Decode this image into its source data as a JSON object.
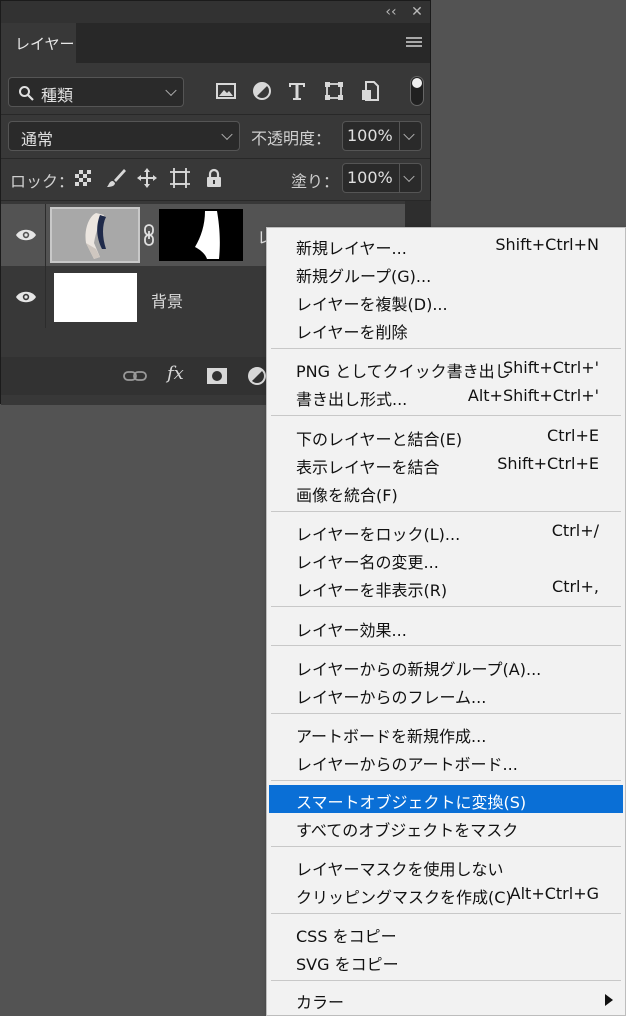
{
  "panel": {
    "tab_label": "レイヤー",
    "collapse_glyph": "‹‹",
    "close_glyph": "✕",
    "filter": {
      "kind_label": "種類"
    },
    "blend_mode": "通常",
    "opacity_label": "不透明度：",
    "opacity_value": "100%",
    "lock_label": "ロック：",
    "fill_label": "塗り：",
    "fill_value": "100%",
    "layers": [
      {
        "name": "レイ",
        "has_mask": true
      },
      {
        "name": "背景",
        "has_mask": false
      }
    ],
    "fx_label": "fx"
  },
  "menu": {
    "items": [
      {
        "label": "新規レイヤー...",
        "shortcut": "Shift+Ctrl+N"
      },
      {
        "label": "新規グループ(G)...",
        "shortcut": ""
      },
      {
        "label": "レイヤーを複製(D)...",
        "shortcut": ""
      },
      {
        "label": "レイヤーを削除",
        "shortcut": ""
      },
      {
        "label": "PNG としてクイック書き出し",
        "shortcut": "Shift+Ctrl+'"
      },
      {
        "label": "書き出し形式...",
        "shortcut": "Alt+Shift+Ctrl+'"
      },
      {
        "label": "下のレイヤーと結合(E)",
        "shortcut": "Ctrl+E"
      },
      {
        "label": "表示レイヤーを結合",
        "shortcut": "Shift+Ctrl+E"
      },
      {
        "label": "画像を統合(F)",
        "shortcut": ""
      },
      {
        "label": "レイヤーをロック(L)...",
        "shortcut": "Ctrl+/"
      },
      {
        "label": "レイヤー名の変更...",
        "shortcut": ""
      },
      {
        "label": "レイヤーを非表示(R)",
        "shortcut": "Ctrl+,"
      },
      {
        "label": "レイヤー効果...",
        "shortcut": ""
      },
      {
        "label": "レイヤーからの新規グループ(A)...",
        "shortcut": ""
      },
      {
        "label": "レイヤーからのフレーム...",
        "shortcut": ""
      },
      {
        "label": "アートボードを新規作成...",
        "shortcut": ""
      },
      {
        "label": "レイヤーからのアートボード...",
        "shortcut": ""
      },
      {
        "label": "スマートオブジェクトに変換(S)",
        "shortcut": "",
        "highlighted": true
      },
      {
        "label": "すべてのオブジェクトをマスク",
        "shortcut": ""
      },
      {
        "label": "レイヤーマスクを使用しない",
        "shortcut": ""
      },
      {
        "label": "クリッピングマスクを作成(C)",
        "shortcut": "Alt+Ctrl+G"
      },
      {
        "label": "CSS をコピー",
        "shortcut": ""
      },
      {
        "label": "SVG をコピー",
        "shortcut": ""
      },
      {
        "label": "カラー",
        "shortcut": "",
        "submenu": true
      }
    ]
  },
  "colors": {
    "highlight": "#0a6fd6",
    "panel_bg": "#383838",
    "menu_bg": "#f2f2f2",
    "workspace_bg": "#535353"
  }
}
